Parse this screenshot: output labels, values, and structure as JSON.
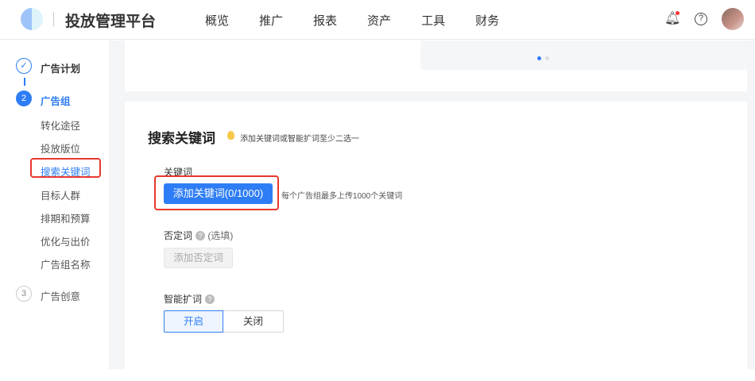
{
  "header": {
    "title": "投放管理平台",
    "nav": [
      "概览",
      "推广",
      "报表",
      "资产",
      "工具",
      "财务"
    ]
  },
  "steps": [
    {
      "num": "✓",
      "label": "广告计划"
    },
    {
      "num": "2",
      "label": "广告组",
      "subs": [
        "转化途径",
        "投放版位",
        "搜索关键词",
        "目标人群",
        "排期和预算",
        "优化与出价",
        "广告组名称"
      ]
    },
    {
      "num": "3",
      "label": "广告创意"
    }
  ],
  "section": {
    "title": "搜索关键词",
    "tip": "添加关键词或智能扩词至少二选一",
    "keyword_label": "关键词",
    "add_keyword_button": "添加关键词(0/1000)",
    "keyword_hint": "每个广告组最多上传1000个关键词",
    "negative_label": "否定词",
    "negative_optional": "(选填)",
    "add_negative_button": "添加否定词",
    "smart_label": "智能扩词",
    "smart_on": "开启",
    "smart_off": "关闭",
    "help_glyph": "?"
  },
  "colors": {
    "accent": "#2e7df6",
    "highlight": "#e8382d"
  }
}
